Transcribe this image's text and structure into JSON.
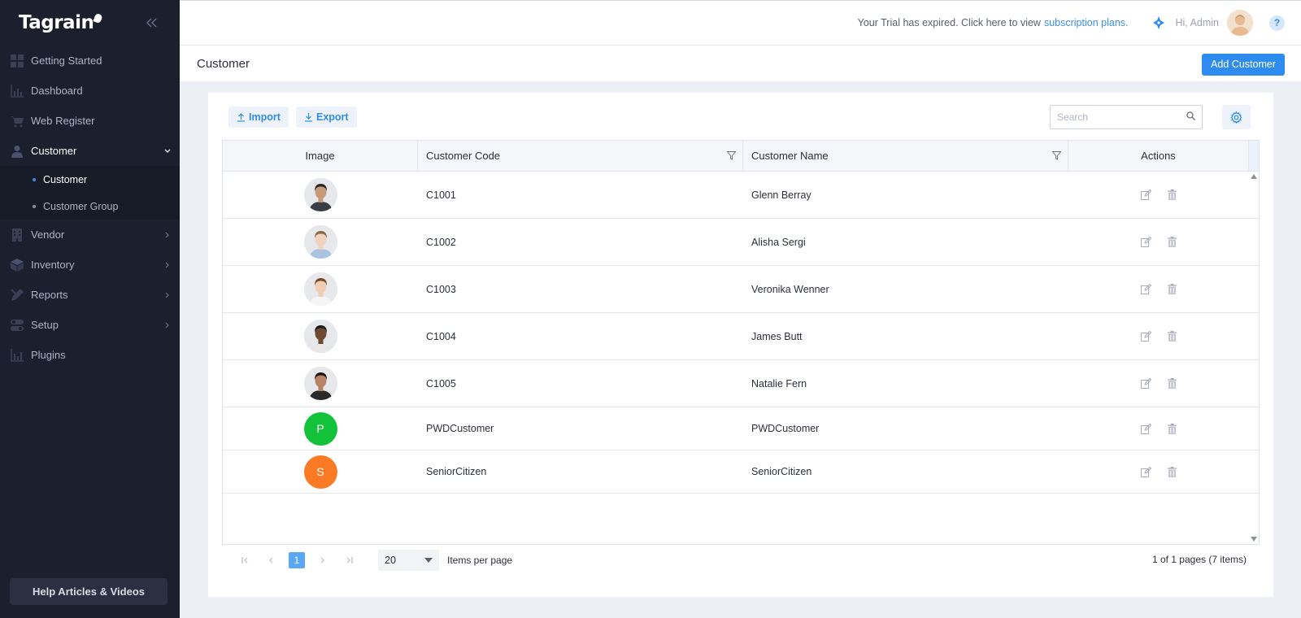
{
  "brand": {
    "name": "Tagrain"
  },
  "sidebar": {
    "items": [
      {
        "label": "Getting Started",
        "icon": "grid-icon"
      },
      {
        "label": "Dashboard",
        "icon": "bar-chart-icon"
      },
      {
        "label": "Web Register",
        "icon": "cart-icon"
      },
      {
        "label": "Customer",
        "icon": "user-icon",
        "expanded": true
      },
      {
        "label": "Vendor",
        "icon": "building-icon"
      },
      {
        "label": "Inventory",
        "icon": "box-icon"
      },
      {
        "label": "Reports",
        "icon": "pencil-ruler-icon"
      },
      {
        "label": "Setup",
        "icon": "toggle-icon"
      },
      {
        "label": "Plugins",
        "icon": "bar-chart-icon"
      }
    ],
    "customer_sub": [
      {
        "label": "Customer",
        "active": true
      },
      {
        "label": "Customer Group",
        "active": false
      }
    ],
    "help_label": "Help Articles & Videos"
  },
  "topbar": {
    "trial_text": "Your Trial has expired. Click here to view",
    "trial_link": "subscription plans.",
    "greeting": "Hi, Admin",
    "help_symbol": "?"
  },
  "page": {
    "title": "Customer",
    "add_button": "Add Customer"
  },
  "toolbar": {
    "import_label": "Import",
    "export_label": "Export",
    "search_placeholder": "Search"
  },
  "table": {
    "columns": [
      "Image",
      "Customer Code",
      "Customer Name",
      "Actions"
    ],
    "rows": [
      {
        "code": "C1001",
        "name": "Glenn Berray",
        "avatar": "photo",
        "hair": "#2a2a2a",
        "skin": "#c79a7a",
        "shirt": "#3a3d45"
      },
      {
        "code": "C1002",
        "name": "Alisha Sergi",
        "avatar": "photo",
        "hair": "#8a6a4a",
        "skin": "#f0d2bf",
        "shirt": "#a9c3e0"
      },
      {
        "code": "C1003",
        "name": "Veronika Wenner",
        "avatar": "photo",
        "hair": "#7a4a2a",
        "skin": "#f1cdb4",
        "shirt": "#f5f5f5"
      },
      {
        "code": "C1004",
        "name": "James Butt",
        "avatar": "photo",
        "hair": "#1f1a16",
        "skin": "#6e4a33",
        "shirt": "#e8e8e8"
      },
      {
        "code": "C1005",
        "name": "Natalie Fern",
        "avatar": "photo",
        "hair": "#1c1410",
        "skin": "#b88465",
        "shirt": "#2a2a2a"
      },
      {
        "code": "PWDCustomer",
        "name": "PWDCustomer",
        "avatar": "initial",
        "initial": "P",
        "color": "#12c23a"
      },
      {
        "code": "SeniorCitizen",
        "name": "SeniorCitizen",
        "avatar": "initial",
        "initial": "S",
        "color": "#fb7a24"
      }
    ]
  },
  "pagination": {
    "current_page": "1",
    "page_size": "20",
    "items_per_page_label": "Items per page",
    "info": "1 of 1 pages (7 items)"
  },
  "colors": {
    "accent": "#2e8cf0",
    "sidebar_bg": "#1c1f2e"
  }
}
